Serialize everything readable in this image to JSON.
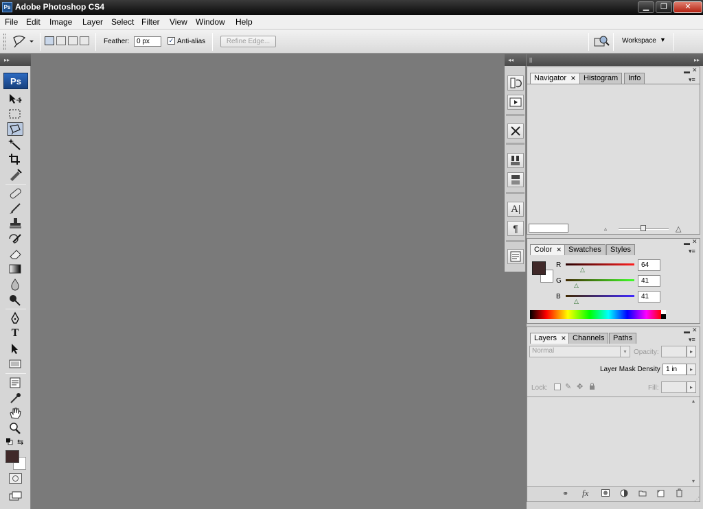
{
  "window": {
    "title": "Adobe Photoshop CS4",
    "app_icon": "Ps",
    "minimize": "▁",
    "restore": "❐",
    "close": "✕"
  },
  "menu": [
    "File",
    "Edit",
    "Image",
    "Layer",
    "Select",
    "Filter",
    "View",
    "Window",
    "Help"
  ],
  "options": {
    "feather_label": "Feather:",
    "feather_value": "0 px",
    "antialias_label": "Anti-alias",
    "antialias_checked": true,
    "refine_edge_label": "Refine Edge...",
    "workspace_label": "Workspace"
  },
  "toolbox": {
    "badge": "Ps",
    "active_tool": "lasso-tool",
    "foreground_color": "#402929",
    "background_color": "#ffffff"
  },
  "navigator_panel": {
    "tabs": [
      "Navigator",
      "Histogram",
      "Info"
    ],
    "active_tab": "Navigator"
  },
  "color_panel": {
    "tabs": [
      "Color",
      "Swatches",
      "Styles"
    ],
    "active_tab": "Color",
    "channels": [
      {
        "label": "R",
        "value": "64",
        "fraction": 0.25
      },
      {
        "label": "G",
        "value": "41",
        "fraction": 0.16
      },
      {
        "label": "B",
        "value": "41",
        "fraction": 0.16
      }
    ]
  },
  "layers_panel": {
    "tabs": [
      "Layers",
      "Channels",
      "Paths"
    ],
    "active_tab": "Layers",
    "blend_mode": "Normal",
    "opacity_label": "Opacity:",
    "mask_density_label": "Layer Mask Density",
    "mask_density_value": "1 in",
    "lock_label": "Lock:",
    "fill_label": "Fill:",
    "footer_fx": "fx"
  }
}
